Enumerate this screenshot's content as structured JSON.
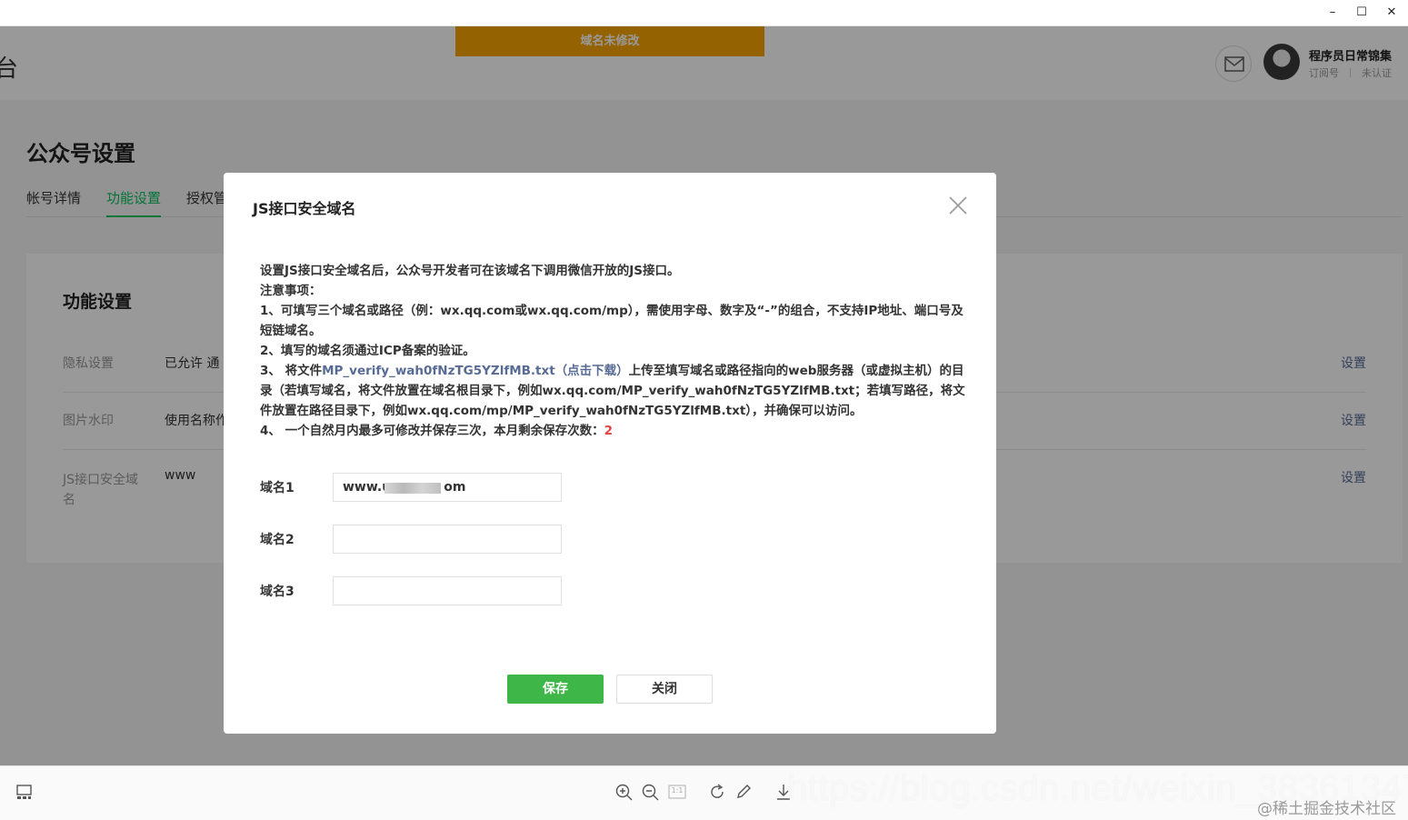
{
  "window": {
    "minimize": "–",
    "maximize": "☐",
    "close": "✕"
  },
  "topbar": {
    "brand_fragment": "台",
    "banner": "域名未修改",
    "account_name": "程序员日常锦集",
    "account_type": "订阅号",
    "account_status": "未认证"
  },
  "page": {
    "title": "公众号设置",
    "tabs": [
      {
        "label": "帐号详情"
      },
      {
        "label": "功能设置"
      },
      {
        "label": "授权管"
      }
    ],
    "active_tab": "功能设置",
    "card_title": "功能设置",
    "rows": [
      {
        "label": "隐私设置",
        "value": "已允许 通",
        "action": "设置"
      },
      {
        "label": "图片水印",
        "value": "使用名称作",
        "action": "设置"
      },
      {
        "label": "JS接口安全域名",
        "value": "www",
        "action": "设置"
      }
    ]
  },
  "dialog": {
    "title": "JS接口安全域名",
    "intro": "设置JS接口安全域名后，公众号开发者可在该域名下调用微信开放的JS接口。",
    "notes_heading": "注意事项：",
    "note1": "1、可填写三个域名或路径（例：wx.qq.com或wx.qq.com/mp），需使用字母、数字及“-”的组合，不支持IP地址、端口号及短链域名。",
    "note2": "2、填写的域名须通过ICP备案的验证。",
    "note3_prefix": "3、 将文件",
    "note3_file": "MP_verify_wah0fNzTG5YZlfMB.txt",
    "note3_download": "（点击下载）",
    "note3_suffix": "上传至填写域名或路径指向的web服务器（或虚拟主机）的目录（若填写域名，将文件放置在域名根目录下，例如wx.qq.com/MP_verify_wah0fNzTG5YZlfMB.txt；若填写路径，将文件放置在路径目录下，例如wx.qq.com/mp/MP_verify_wah0fNzTG5YZlfMB.txt），并确保可以访问。",
    "note4_prefix": "4、 一个自然月内最多可修改并保存三次，本月剩余保存次数：",
    "note4_count": "2",
    "fields": [
      {
        "label": "域名1",
        "value_start": "www.u",
        "value_end": "om"
      },
      {
        "label": "域名2",
        "value": ""
      },
      {
        "label": "域名3",
        "value": ""
      }
    ],
    "save_label": "保存",
    "close_label": "关闭"
  },
  "viewer": {
    "zoom_reset": "1:1"
  },
  "watermarks": {
    "url": "https://blog.csdn.net/weixin_38361347",
    "community": "@稀土掘金技术社区"
  },
  "colors": {
    "banner": "#f9a400",
    "primary": "#3eb748",
    "link": "#576b95",
    "count": "#e64340",
    "tab_active": "#07c160"
  }
}
